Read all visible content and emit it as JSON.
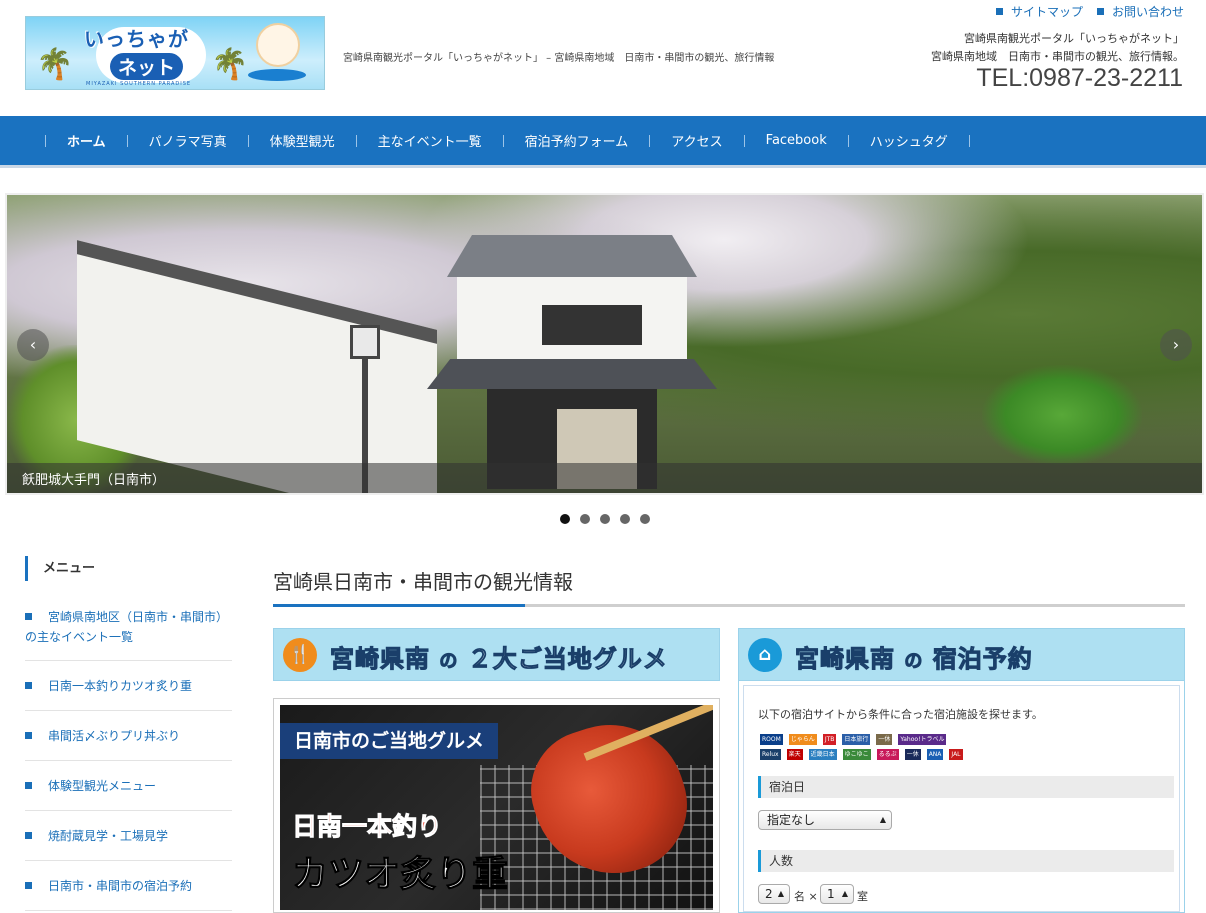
{
  "header": {
    "logo_text_top": "いっちゃが",
    "logo_text_bottom": "ネット",
    "logo_subtext": "MIYAZAKI SOUTHERN PARADISE",
    "tagline": "宮崎県南観光ポータル「いっちゃがネット」 – 宮崎県南地域　日南市・串間市の観光、旅行情報",
    "links": [
      "サイトマップ",
      "お問い合わせ"
    ],
    "right_line1": "宮崎県南観光ポータル「いっちゃがネット」",
    "right_line2": "宮崎県南地域　日南市・串間市の観光、旅行情報。",
    "tel": "TEL:0987-23-2211"
  },
  "nav": {
    "items": [
      {
        "label": "ホーム",
        "active": true
      },
      {
        "label": "パノラマ写真",
        "active": false
      },
      {
        "label": "体験型観光",
        "active": false
      },
      {
        "label": "主なイベント一覧",
        "active": false
      },
      {
        "label": "宿泊予約フォーム",
        "active": false
      },
      {
        "label": "アクセス",
        "active": false
      },
      {
        "label": "Facebook",
        "active": false
      },
      {
        "label": "ハッシュタグ",
        "active": false
      }
    ]
  },
  "slider": {
    "caption": "飫肥城大手門（日南市）",
    "prev": "‹",
    "next": "›",
    "slide_count": 5,
    "active_index": 0
  },
  "sidebar": {
    "title": "メニュー",
    "items": [
      "宮崎県南地区（日南市・串間市）の主なイベント一覧",
      "日南一本釣りカツオ炙り重",
      "串間活〆ぶりプリ丼ぶり",
      "体験型観光メニュー",
      "焼酎蔵見学・工場見学",
      "日南市・串間市の宿泊予約"
    ]
  },
  "main": {
    "title": "宮崎県日南市・串間市の観光情報",
    "gourmet_banner": {
      "icon": "🍴",
      "text_a": "宮崎県南",
      "text_no": "の",
      "text_b": "２大ご当地グルメ"
    },
    "hotel_banner": {
      "icon": "⌂",
      "text_a": "宮崎県南",
      "text_no": "の",
      "text_b": "宿泊予約"
    },
    "food_image": {
      "tag": "日南市のご当地グルメ",
      "line1": "日南一本釣り",
      "line2": "カツオ炙り重"
    },
    "hotel": {
      "intro": "以下の宿泊サイトから条件に合った宿泊施設を探せます。",
      "site_logos": [
        "ROOM",
        "じゃらん",
        "JTB",
        "日本旅行",
        "一休",
        "Yahoo!トラベル",
        "Relux",
        "楽天",
        "近畿日本",
        "ゆこゆこ",
        "るるぶ",
        "一休",
        "ANA",
        "JAL"
      ],
      "date_label": "宿泊日",
      "date_value": "指定なし",
      "people_label": "人数",
      "people_value": "2",
      "people_unit": "名 ×",
      "rooms_value": "1",
      "rooms_unit": "室"
    }
  },
  "colors": {
    "nav_bg": "#1a72c0",
    "link": "#1a6fb8",
    "banner_bg": "#aee0f2",
    "accent_orange": "#f08c1c"
  }
}
